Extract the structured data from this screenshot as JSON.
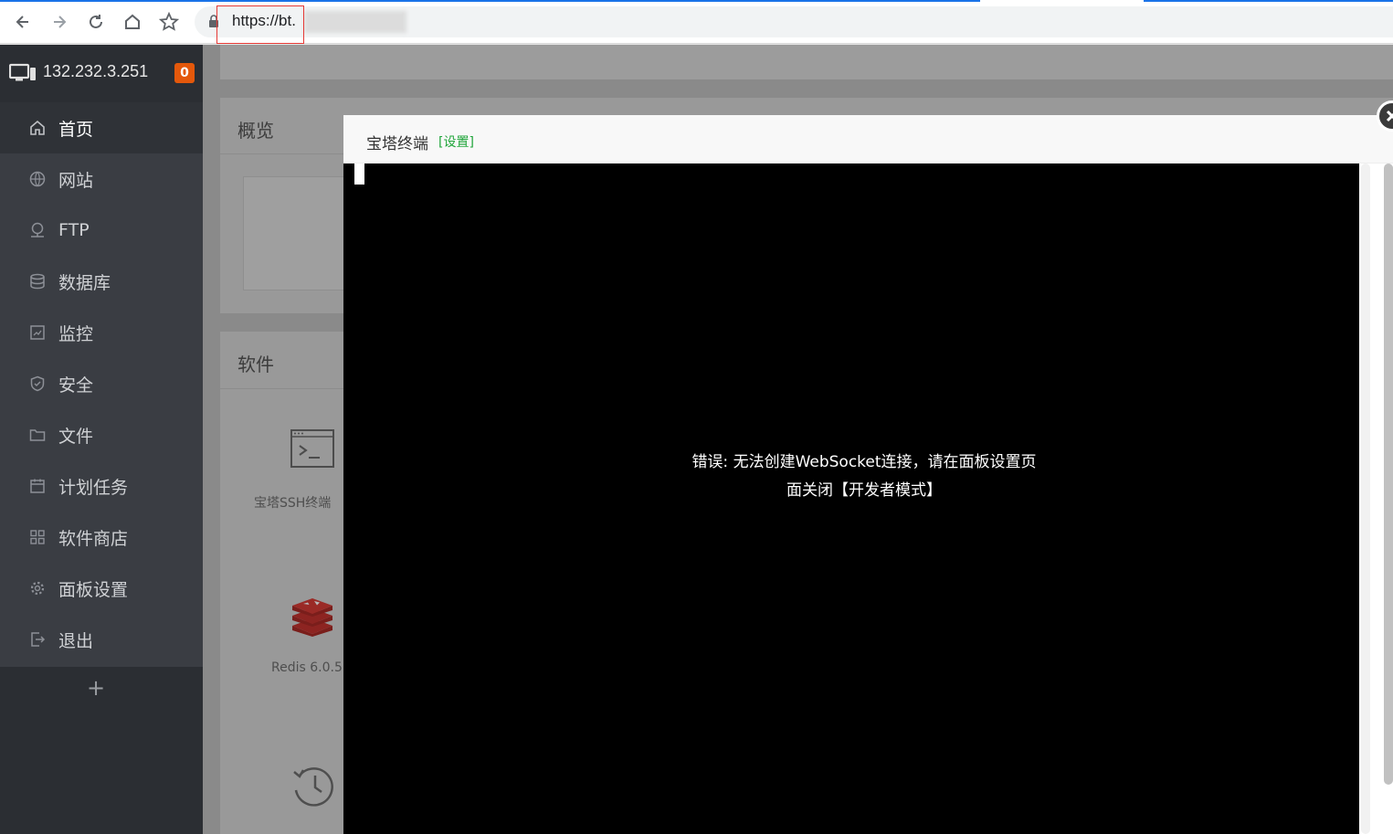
{
  "browser": {
    "url_prefix": "https://bt.",
    "back_icon": "arrow-left-icon",
    "forward_icon": "arrow-right-icon",
    "reload_icon": "reload-icon",
    "home_icon": "home-icon",
    "bookmark_icon": "star-icon",
    "accent_color": "#1a73e8"
  },
  "sidebar": {
    "server_ip": "132.232.3.251",
    "badge_count": "0",
    "items": [
      {
        "label": "首页",
        "icon": "home-icon"
      },
      {
        "label": "网站",
        "icon": "globe-icon"
      },
      {
        "label": "FTP",
        "icon": "ftp-icon"
      },
      {
        "label": "数据库",
        "icon": "database-icon"
      },
      {
        "label": "监控",
        "icon": "monitor-chart-icon"
      },
      {
        "label": "安全",
        "icon": "shield-icon"
      },
      {
        "label": "文件",
        "icon": "folder-icon"
      },
      {
        "label": "计划任务",
        "icon": "calendar-icon"
      },
      {
        "label": "软件商店",
        "icon": "grid-icon"
      },
      {
        "label": "面板设置",
        "icon": "gear-icon"
      },
      {
        "label": "退出",
        "icon": "logout-icon"
      }
    ],
    "add_label": "+"
  },
  "page": {
    "overview_title": "概览",
    "software_title": "软件",
    "software_items": [
      {
        "label": "宝塔SSH终端",
        "icon": "terminal-icon"
      },
      {
        "label": "Redis 6.0.5",
        "icon": "redis-icon"
      },
      {
        "label": "",
        "icon": "history-clock-icon"
      }
    ]
  },
  "modal": {
    "title": "宝塔终端",
    "settings_link": "[设置]",
    "error_line1": "错误: 无法创建WebSocket连接，请在面板设置页",
    "error_line2": "面关闭【开发者模式】",
    "close_icon": "close-icon",
    "settings_color": "#20a53a"
  }
}
